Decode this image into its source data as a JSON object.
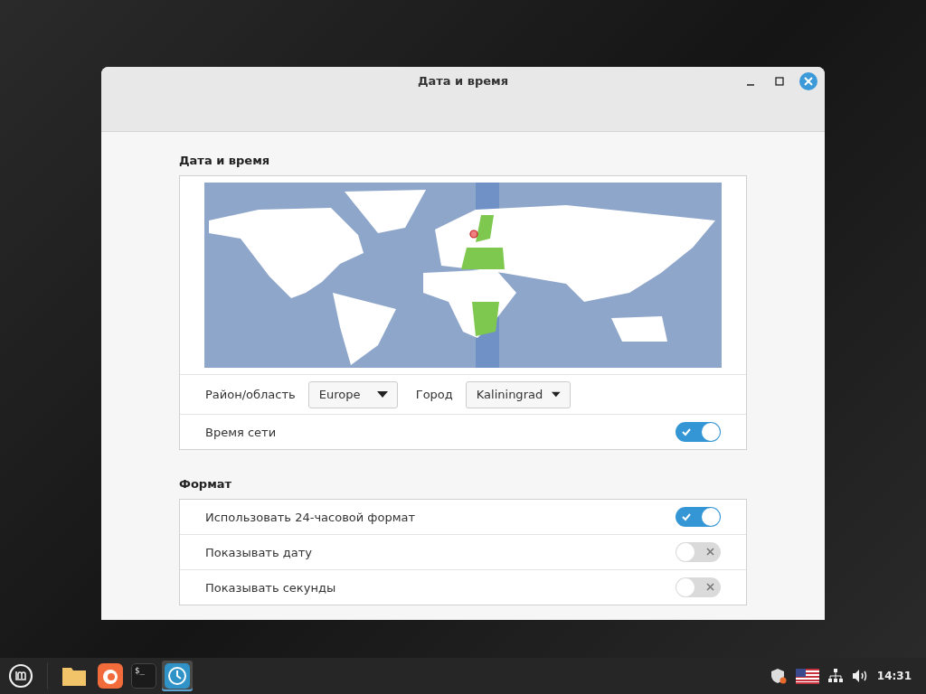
{
  "window": {
    "title": "Дата и время"
  },
  "date_time": {
    "title": "Дата и время",
    "region_label": "Район/область",
    "region": "Europe",
    "city_label": "Город",
    "city": "Kaliningrad",
    "network_time": {
      "label": "Время сети",
      "on": true
    }
  },
  "format": {
    "title": "Формат",
    "rows": [
      {
        "label": "Использовать 24-часовой формат",
        "on": true
      },
      {
        "label": "Показывать дату",
        "on": false
      },
      {
        "label": "Показывать секунды",
        "on": false
      }
    ]
  },
  "taskbar": {
    "apps": [
      {
        "kind": "files",
        "selected": false
      },
      {
        "kind": "browser",
        "selected": false
      },
      {
        "kind": "terminal",
        "selected": false,
        "glyph": "$_"
      },
      {
        "kind": "clock",
        "selected": true
      }
    ],
    "clock": "14:31"
  }
}
